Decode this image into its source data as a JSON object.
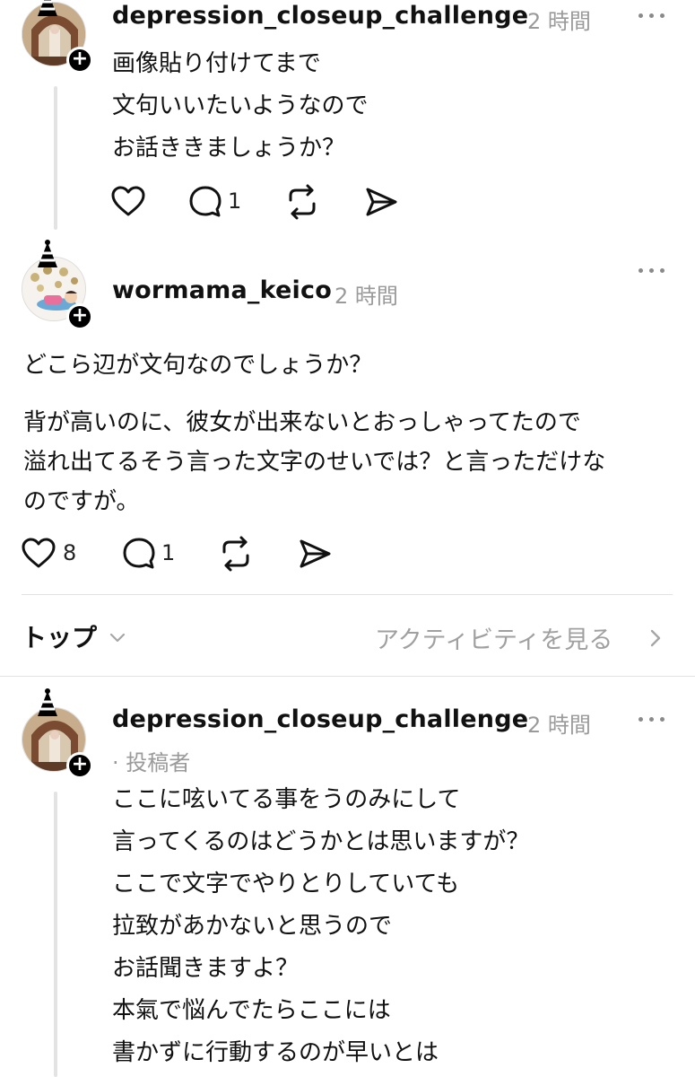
{
  "posts": [
    {
      "username": "depression_closeup_challenge",
      "time": "2 時間",
      "lines": [
        "画像貼り付けてまで",
        "文句いいたいようなので",
        "お話ききましょうか？"
      ],
      "likes": "",
      "replies": "1"
    },
    {
      "username": "wormama_keico",
      "time": "2 時間",
      "lines": [
        "どこら辺が文句なのでしょうか？",
        "背が高いのに、彼女が出来ないとおっしゃってたので",
        "溢れ出てるそう言った文字のせいでは？と言っただけな",
        "のですが。"
      ],
      "likes": "8",
      "replies": "1"
    },
    {
      "username": "depression_closeup_challenge",
      "time": "2 時間",
      "badge": "· 投稿者",
      "lines": [
        "ここに呟いてる事をうのみにして",
        "言ってくるのはどうかとは思いますが？",
        "ここで文字でやりとりしていても",
        "拉致があかないと思うので",
        "お話聞きますよ？",
        "本氣で悩んでたらここには",
        "書かずに行動するのが早いとは"
      ]
    }
  ],
  "sort_bar": {
    "sort_label": "トップ",
    "activity_link": "アクティビティを見る"
  },
  "icons": {
    "more": "more-horizontal-icon",
    "like": "heart-icon",
    "reply": "comment-bubble-icon",
    "repost": "repost-icon",
    "share": "send-icon",
    "sort": "chevron-down-icon",
    "activity": "chevron-right-icon"
  }
}
